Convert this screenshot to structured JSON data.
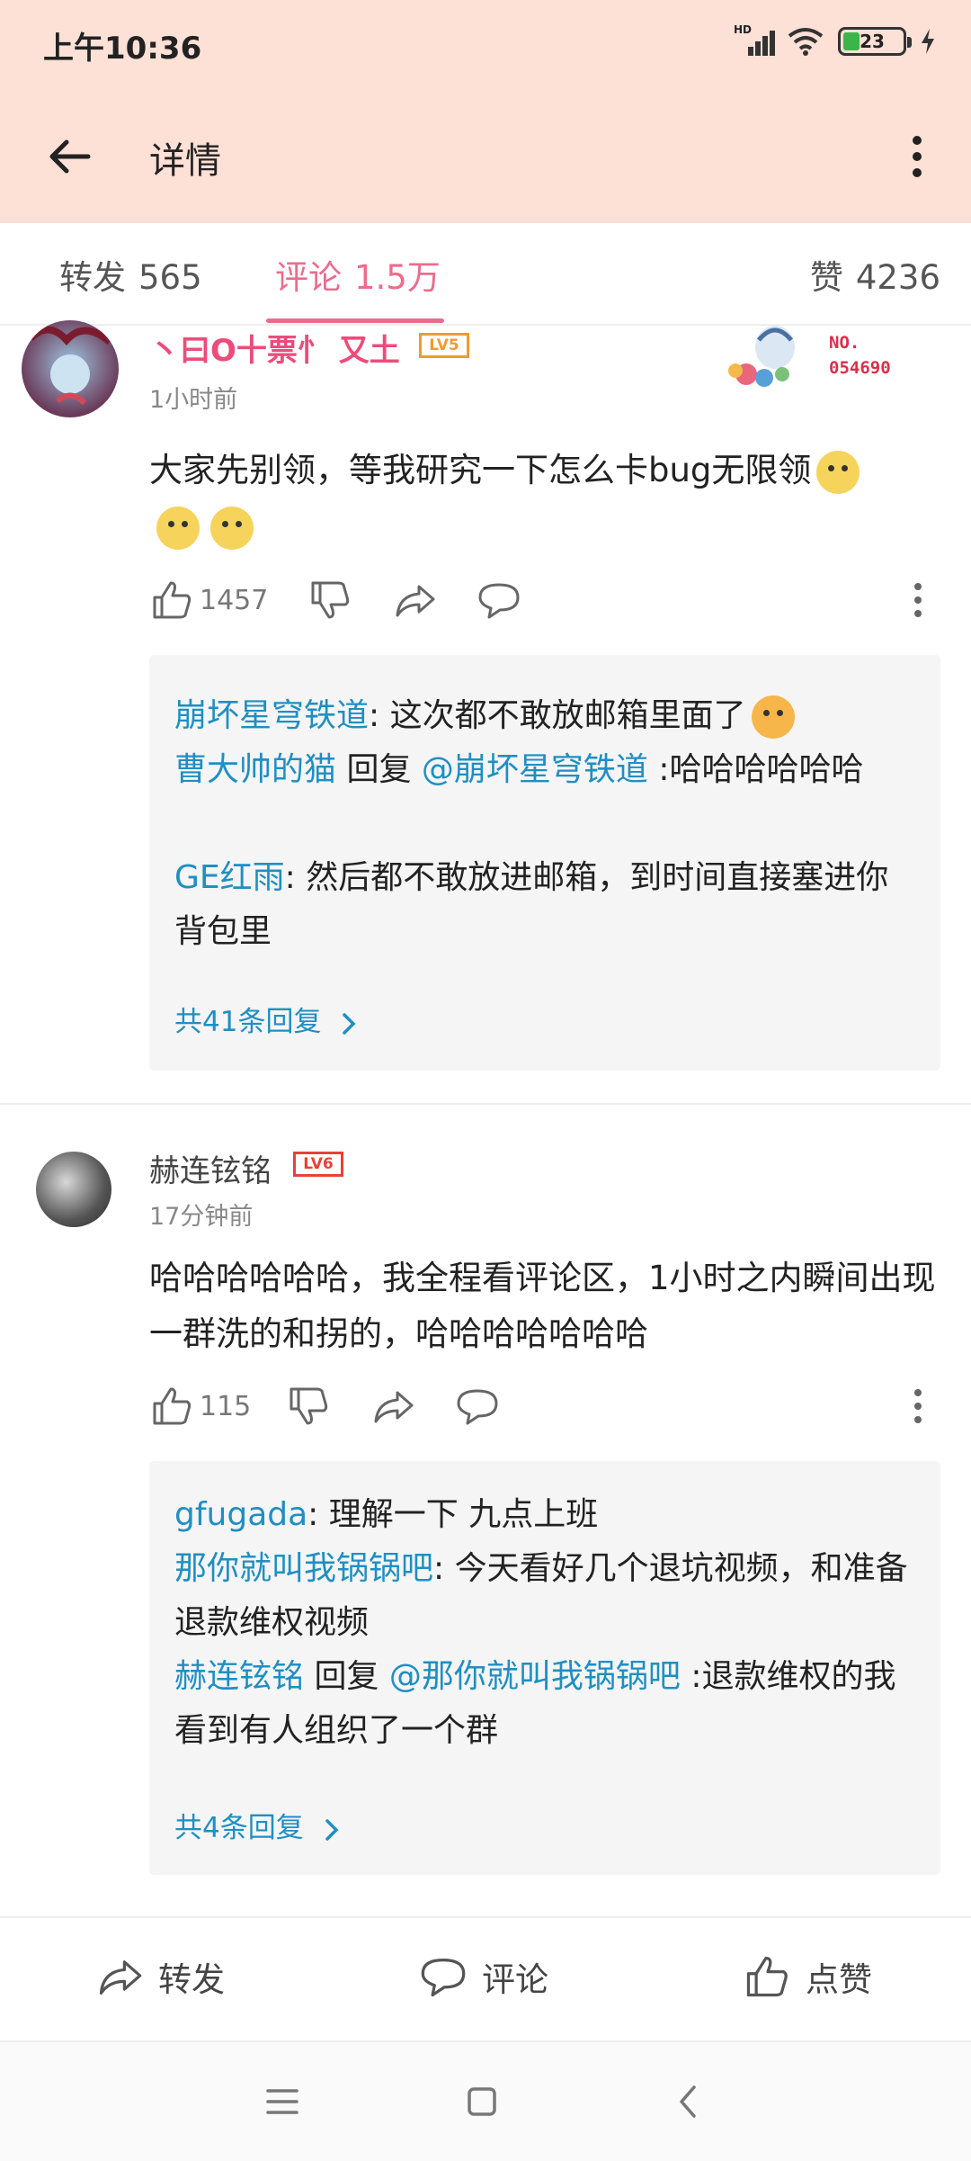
{
  "status": {
    "time": "上午10:36",
    "battery": "23",
    "hd": "HD"
  },
  "header": {
    "title": "详情"
  },
  "tabs": {
    "repost_label": "转发",
    "repost_count": "565",
    "comment_label": "评论",
    "comment_count": "1.5万",
    "like_label": "赞",
    "like_count": "4236"
  },
  "comments": [
    {
      "username": "丶曰O十票忄 又土",
      "level": "LV5",
      "badge_text": "NO.",
      "badge_number": "054690",
      "time": "1小时前",
      "text": "大家先别领，等我研究一下怎么卡bug无限领",
      "likes": "1457",
      "replies": [
        {
          "user": "崩坏星穹铁道",
          "sep": ": ",
          "text": "这次都不敢放邮箱里面了"
        },
        {
          "user": "曹大帅的猫",
          "reply_word": " 回复 ",
          "target": "@崩坏星穹铁道",
          "text": " :哈哈哈哈哈哈"
        },
        {
          "user": "GE红雨",
          "sep": ": ",
          "text": "然后都不敢放进邮箱，到时间直接塞进你背包里"
        }
      ],
      "more_replies": "共41条回复"
    },
    {
      "username": "赫连铉铭",
      "level": "LV6",
      "time": "17分钟前",
      "text": "哈哈哈哈哈哈，我全程看评论区，1小时之内瞬间出现一群洗的和拐的，哈哈哈哈哈哈哈",
      "likes": "115",
      "replies": [
        {
          "user": "gfugada",
          "sep": ": ",
          "text": "理解一下 九点上班"
        },
        {
          "user": "那你就叫我锅锅吧",
          "sep": ": ",
          "text": "今天看好几个退坑视频，和准备退款维权视频"
        },
        {
          "user": "赫连铉铭",
          "reply_word": " 回复 ",
          "target": "@那你就叫我锅锅吧",
          "text": " :退款维权的我看到有人组织了一个群"
        }
      ],
      "more_replies": "共4条回复"
    }
  ],
  "bottom_bar": {
    "repost": "转发",
    "comment": "评论",
    "like": "点赞"
  },
  "icons": {
    "back": "back-arrow-icon",
    "more": "more-vertical-icon",
    "like": "thumbs-up-icon",
    "dislike": "thumbs-down-icon",
    "share": "share-arrow-icon",
    "comment": "comment-bubble-icon"
  },
  "colors": {
    "accent": "#ec6b8e",
    "link": "#1f8fc2",
    "header_bg": "#fde0d6",
    "level_orange": "#f29a2e",
    "level_red": "#e8403a"
  }
}
